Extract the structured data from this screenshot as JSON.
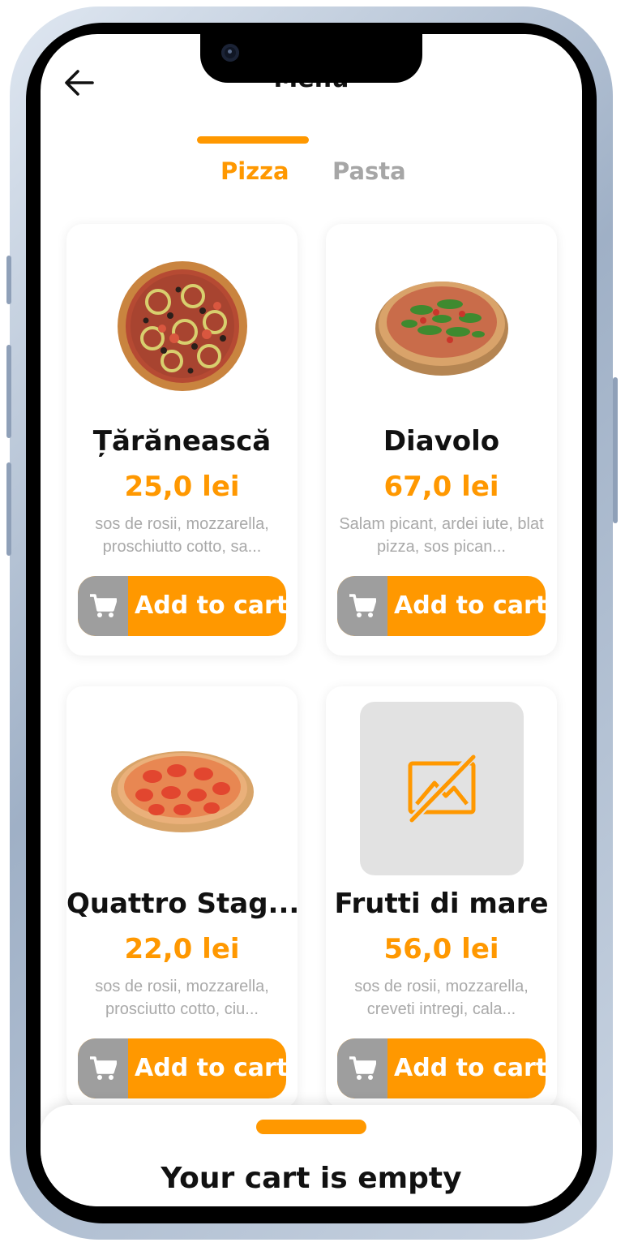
{
  "header": {
    "title": "Menu"
  },
  "tabs": [
    {
      "label": "Pizza",
      "active": true
    },
    {
      "label": "Pasta",
      "active": false
    }
  ],
  "products": [
    {
      "name": "Țărănească",
      "price": "25,0 lei",
      "description": "sos de rosii, mozzarella, proschiutto cotto, sa...",
      "image": "pizza-taraneasca-photo",
      "button": "Add to cart"
    },
    {
      "name": "Diavolo",
      "price": "67,0 lei",
      "description": "Salam picant, ardei iute, blat pizza, sos pican...",
      "image": "pizza-diavolo-photo",
      "button": "Add to cart"
    },
    {
      "name": "Quattro Stag...",
      "price": "22,0 lei",
      "description": "sos de rosii, mozzarella, prosciutto cotto, ciu...",
      "image": "pizza-quattro-photo",
      "button": "Add to cart"
    },
    {
      "name": "Frutti di mare",
      "price": "56,0 lei",
      "description": "sos de rosii, mozzarella, creveti intregi, cala...",
      "image": "no-image-placeholder-icon",
      "button": "Add to cart"
    }
  ],
  "cart": {
    "status": "Your cart is empty"
  },
  "colors": {
    "accent": "#ff9800",
    "muted": "#9e9e9e",
    "text": "#111111"
  }
}
